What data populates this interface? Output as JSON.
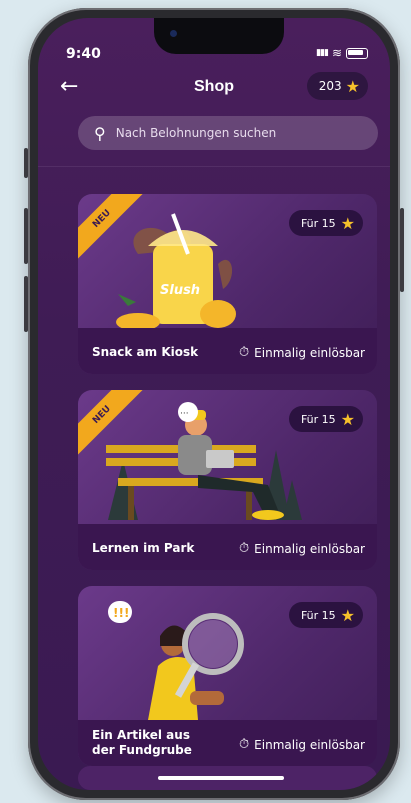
{
  "status": {
    "time": "9:40",
    "signal": "▮▮▮",
    "wifi": "≋"
  },
  "header": {
    "back_icon": "arrow-left-icon",
    "title": "Shop",
    "balance": "203"
  },
  "search": {
    "placeholder": "Nach Belohnungen suchen"
  },
  "cards": [
    {
      "title": "Snack am Kiosk",
      "price": "Für 15",
      "badge": "NEU",
      "availability": "Einmalig einlösbar",
      "illustration_text": "Slush"
    },
    {
      "title": "Lernen im Park",
      "price": "Für 15",
      "badge": "NEU",
      "availability": "Einmalig einlösbar",
      "bubble": "···"
    },
    {
      "title": "Ein Artikel aus der Fundgrube",
      "price": "Für 15",
      "badge": "",
      "availability": "Einmalig einlösbar",
      "bubble": "!!!"
    }
  ],
  "colors": {
    "accent_star": "#f6c12b",
    "ribbon": "#f2a81d",
    "background": "#4a1f5c"
  }
}
